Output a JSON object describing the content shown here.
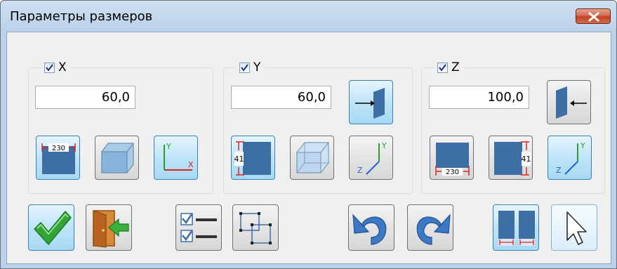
{
  "window": {
    "title": "Параметры размеров"
  },
  "groups": {
    "x": {
      "label": "X",
      "checked": true,
      "value": "60,0",
      "buttons": [
        {
          "icon": "width-dimension-icon",
          "text": "230"
        },
        {
          "icon": "box-3d-icon"
        },
        {
          "icon": "xy-axes-icon",
          "axis_y": "Y",
          "axis_x": "X"
        }
      ]
    },
    "y": {
      "label": "Y",
      "checked": true,
      "value": "60,0",
      "buttons": [
        {
          "icon": "height-dimension-left-icon",
          "text": "41"
        },
        {
          "icon": "box-3d-transparent-icon"
        },
        {
          "icon": "zy-axes-icon",
          "axis_y": "Y",
          "axis_z": "Z"
        }
      ],
      "extra_icon": "arrow-into-plane-icon"
    },
    "z": {
      "label": "Z",
      "checked": true,
      "value": "100,0",
      "buttons": [
        {
          "icon": "width-dimension-bottom-icon",
          "text": "230"
        },
        {
          "icon": "height-dimension-right-icon",
          "text": "41"
        },
        {
          "icon": "zy-axes-icon",
          "axis_y": "Y",
          "axis_z": "Z"
        }
      ],
      "extra_icon": "arrow-from-plane-icon"
    }
  },
  "footer_icons": [
    "ok-check-icon",
    "exit-door-icon",
    "checklist-icon",
    "select-frames-icon",
    "undo-icon",
    "redo-icon",
    "split-columns-icon",
    "cursor-pointer-icon"
  ],
  "colors": {
    "accent_blue": "#3d6ea4",
    "dim_red": "#e02424",
    "axis_green": "#2a9d2a",
    "check_green": "#31a536"
  }
}
